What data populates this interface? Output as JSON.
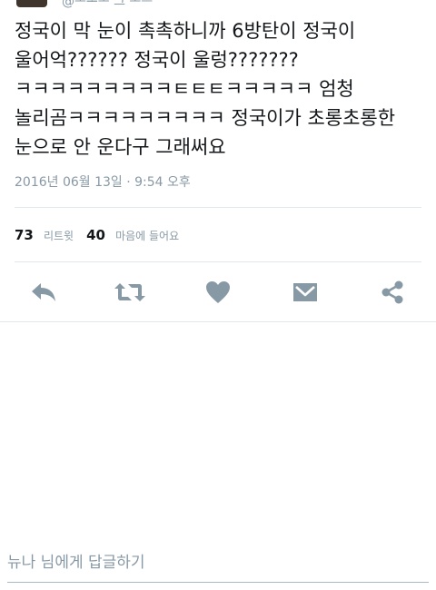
{
  "header": {
    "handle_fragment": "@ᅩᅳᅩᅩ 그 ᅩᅳ"
  },
  "tweet": {
    "text": "정국이 막 눈이 촉촉하니까 6방탄이 정국이\n울어억?????? 정국이 울렁???????\nㅋㅋㅋㅋㅋㅋㅋㅋㅋㅌㅌㅌㅋㅋㅋㅋㅋ 엄청\n놀리곰ㅋㅋㅋㅋㅋㅋㅋㅋㅋ 정국이가 초롱초롱한\n눈으로 안 운다구 그래써요",
    "timestamp": "2016년 06월 13일 · 9:54 오후"
  },
  "stats": {
    "retweets": {
      "count": "73",
      "label": "리트윗"
    },
    "likes": {
      "count": "40",
      "label": "마음에 들어요"
    }
  },
  "actions": [
    {
      "name": "reply",
      "icon": "reply-icon"
    },
    {
      "name": "retweet",
      "icon": "retweet-icon"
    },
    {
      "name": "like",
      "icon": "heart-icon"
    },
    {
      "name": "message",
      "icon": "envelope-icon"
    },
    {
      "name": "share",
      "icon": "share-icon"
    }
  ],
  "reply": {
    "placeholder": "뉴나 님에게 답글하기"
  },
  "colors": {
    "text": "#14171a",
    "secondary": "#8899a6",
    "icon": "#8899a6",
    "divider": "#e1e8ed"
  }
}
